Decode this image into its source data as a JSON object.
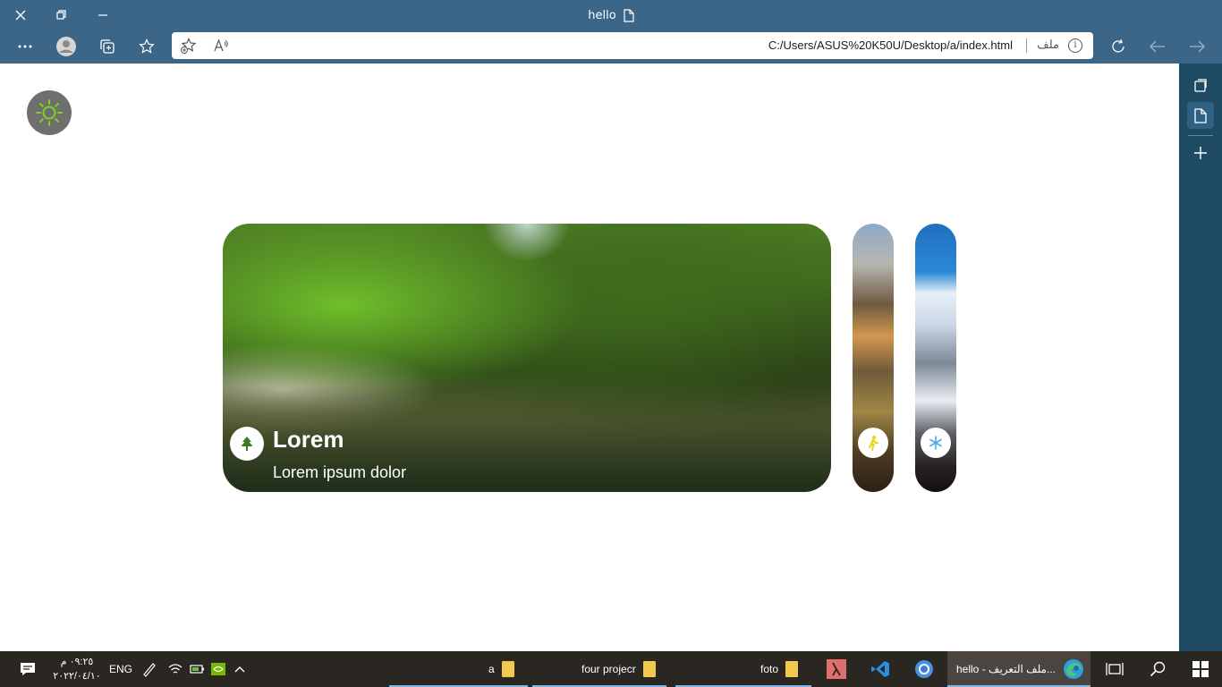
{
  "browser": {
    "tab_title": "hello",
    "url": "C:/Users/ASUS%20K50U/Desktop/a/index.html",
    "security_badge": "ملف"
  },
  "page": {
    "cards": [
      {
        "icon": "tree-icon",
        "title": "Lorem",
        "subtitle": "Lorem ipsum dolor"
      },
      {
        "icon": "hiker-icon"
      },
      {
        "icon": "snowflake-icon"
      }
    ]
  },
  "taskbar": {
    "clock_time": "٠٩:٢٥ م",
    "clock_date": "٢٠٢٢/٠٤/١٠",
    "language": "ENG",
    "apps": [
      {
        "label": "a"
      },
      {
        "label": "four projecr"
      },
      {
        "label": "foto"
      },
      {
        "label": "hello - ملف التعريف..."
      }
    ]
  },
  "colors": {
    "chrome": "#3b6688",
    "sidebar": "#1f4a63",
    "taskbar": "#2a2622",
    "toggle_bg": "#6f6f6f",
    "sun": "#7ed321"
  }
}
